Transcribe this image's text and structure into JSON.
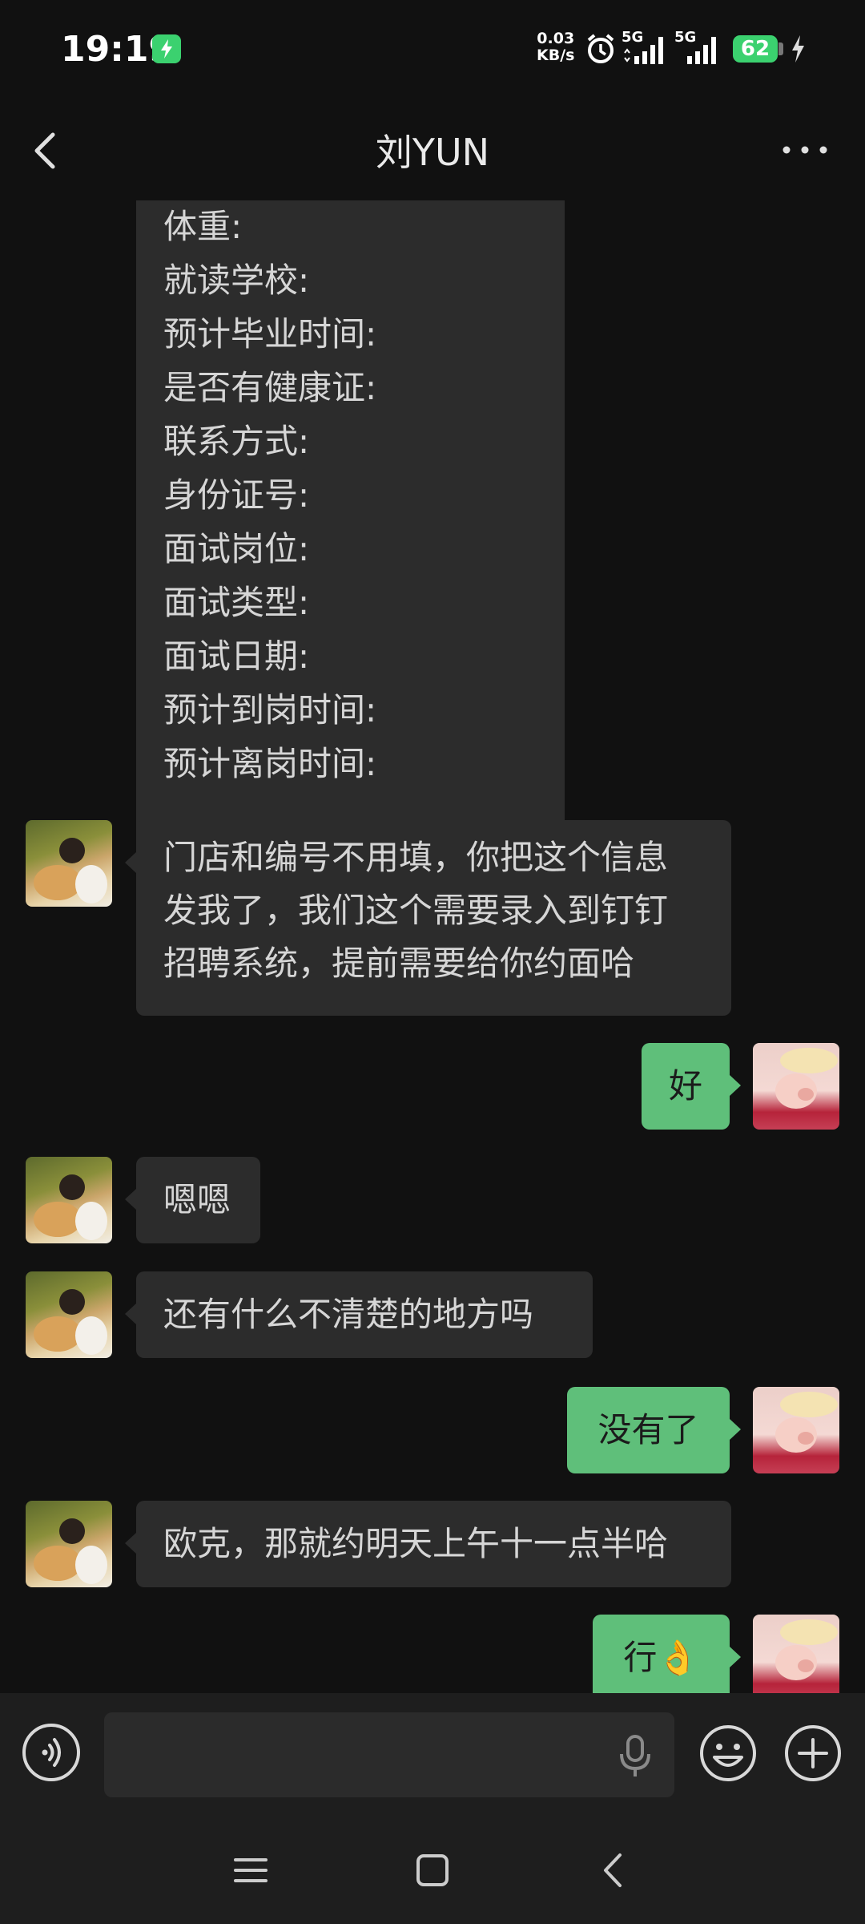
{
  "status_bar": {
    "time": "19:19",
    "net_speed_value": "0.03",
    "net_speed_unit": "KB/s",
    "signal_1_label": "5G",
    "signal_2_label": "5G",
    "battery_level": "62",
    "icons": [
      "charging-app-icon",
      "alarm-icon",
      "signal-5g-icon",
      "signal-5g-icon",
      "battery-icon",
      "charging-bolt-icon"
    ]
  },
  "header": {
    "title": "刘YUN"
  },
  "messages": {
    "form": {
      "sender": "contact",
      "lines": [
        "体重:",
        "就读学校:",
        "预计毕业时间:",
        "是否有健康证:",
        "联系方式:",
        "身份证号:",
        "面试岗位:",
        "面试类型:",
        "面试日期:",
        "预计到岗时间:",
        "预计离岗时间:"
      ]
    },
    "m1": {
      "sender": "contact",
      "lines": [
        "门店和编号不用填，你把这个信息",
        "发我了，我们这个需要录入到钉钉",
        "招聘系统，提前需要给你约面哈"
      ]
    },
    "m2": {
      "sender": "me",
      "text": "好"
    },
    "m3": {
      "sender": "contact",
      "text": "嗯嗯"
    },
    "m4": {
      "sender": "contact",
      "text": "还有什么不清楚的地方吗"
    },
    "m5": {
      "sender": "me",
      "text": "没有了"
    },
    "m6": {
      "sender": "contact",
      "text": "欧克，那就约明天上午十一点半哈"
    },
    "m7": {
      "sender": "me",
      "text": "行👌"
    }
  },
  "input_bar": {
    "placeholder": ""
  },
  "colors": {
    "background": "#111111",
    "incoming_bubble": "#2c2c2c",
    "outgoing_bubble": "#5fbf7a",
    "battery": "#3bd16f"
  }
}
